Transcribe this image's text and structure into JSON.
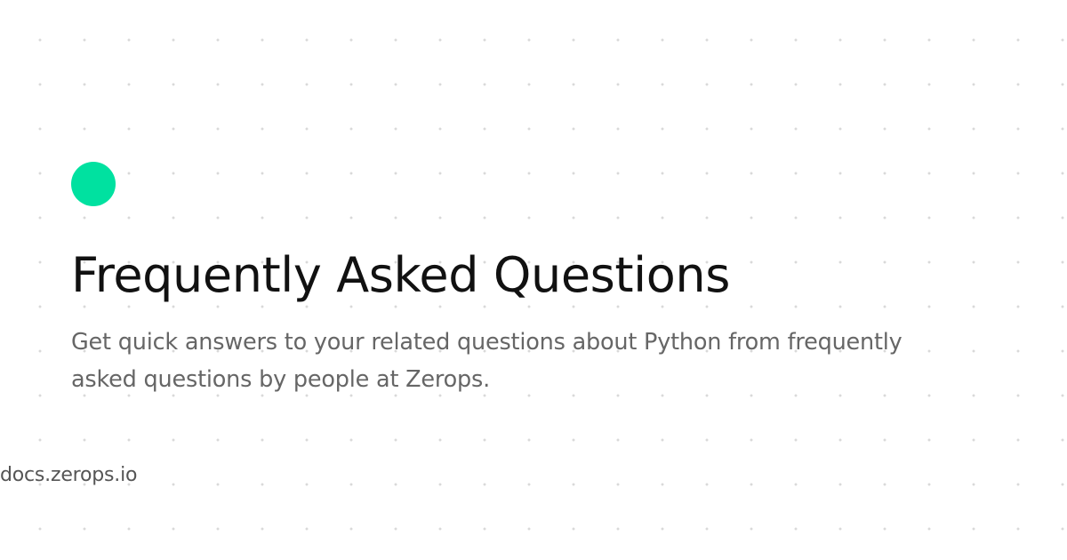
{
  "colors": {
    "accent": "#00E1A0",
    "title": "#111111",
    "subtitle": "#666666",
    "domain": "#555555",
    "background": "#FFFFFF",
    "dot_pattern": "#D9D9D9"
  },
  "icon": "brand-dot-icon",
  "title": "Frequently Asked Questions",
  "subtitle": "Get quick answers to your related questions about Python from frequently asked questions by people at Zerops.",
  "domain": "docs.zerops.io"
}
